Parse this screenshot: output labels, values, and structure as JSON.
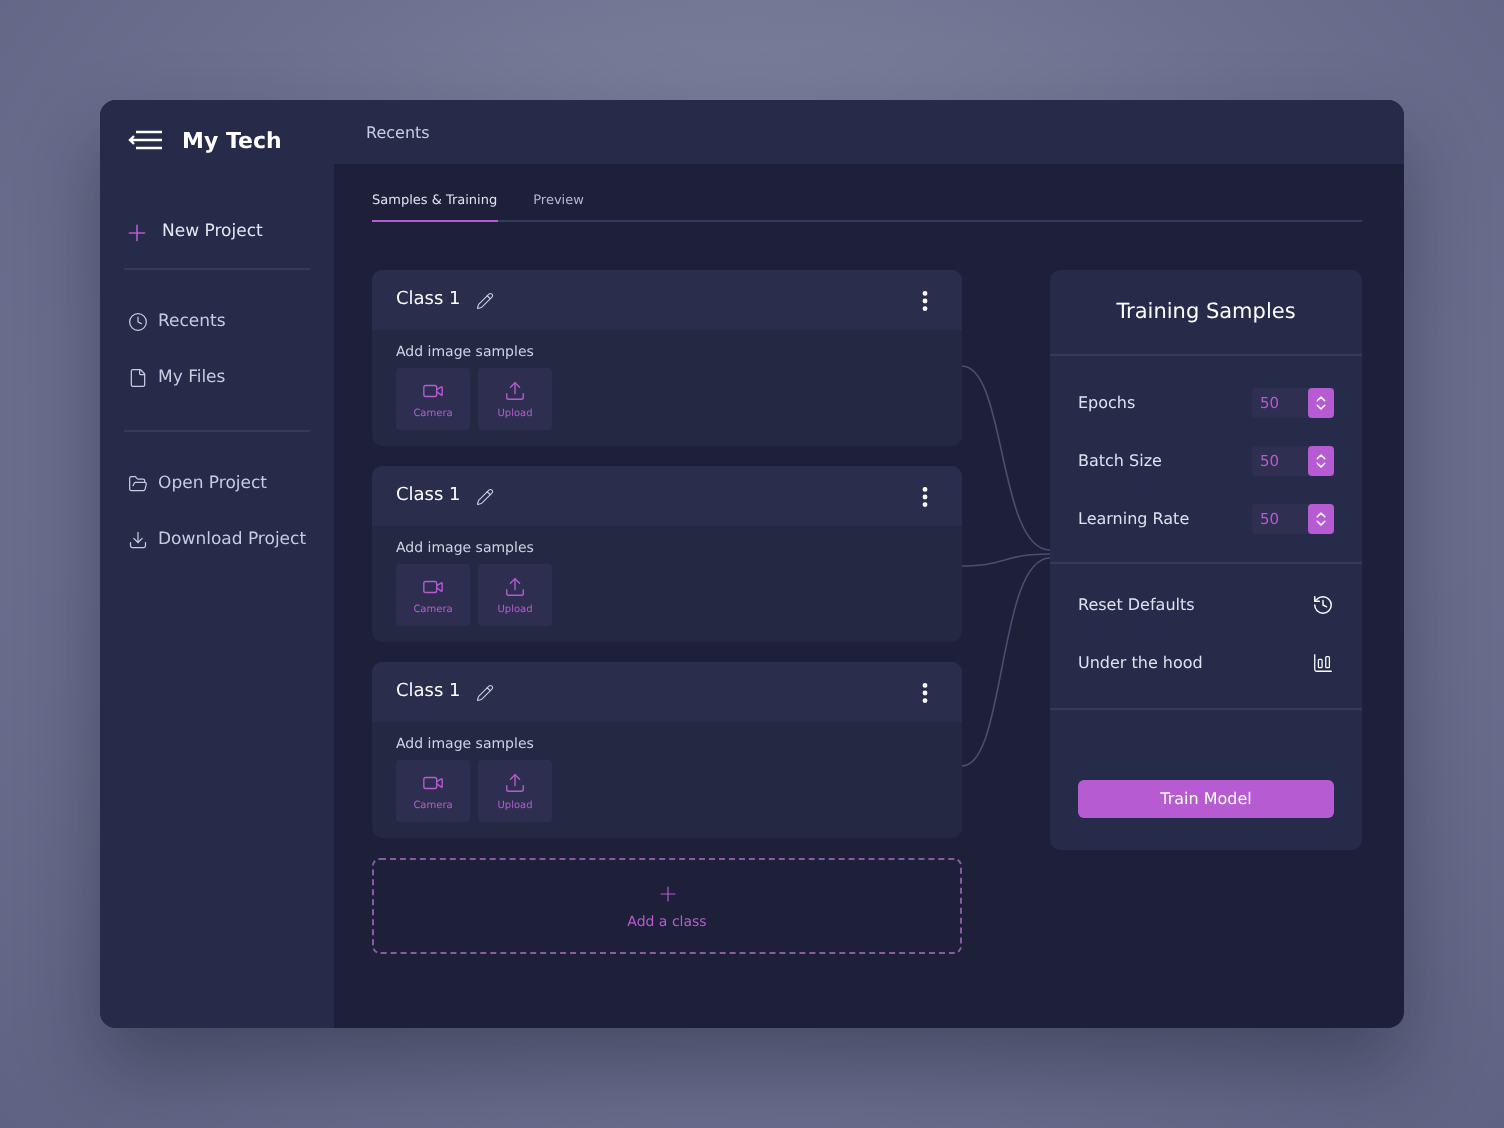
{
  "sidebar": {
    "title": "My Tech",
    "new_project": "New Project",
    "items": [
      {
        "label": "Recents",
        "kind": "clock"
      },
      {
        "label": "My Files",
        "kind": "file"
      }
    ],
    "actions": [
      {
        "label": "Open Project",
        "kind": "folder"
      },
      {
        "label": "Download Project",
        "kind": "download"
      }
    ]
  },
  "header": {
    "title": "Recents"
  },
  "tabs": [
    {
      "label": "Samples & Training",
      "selected": true
    },
    {
      "label": "Preview",
      "selected": false
    }
  ],
  "classes": [
    {
      "name": "Class 1",
      "prompt": "Add image samples",
      "buttons": [
        "Camera",
        "Upload"
      ]
    },
    {
      "name": "Class 1",
      "prompt": "Add image samples",
      "buttons": [
        "Camera",
        "Upload"
      ]
    },
    {
      "name": "Class 1",
      "prompt": "Add image samples",
      "buttons": [
        "Camera",
        "Upload"
      ]
    }
  ],
  "add_class": "Add a class",
  "training": {
    "title": "Training Samples",
    "params": [
      {
        "label": "Epochs",
        "value": "50"
      },
      {
        "label": "Batch Size",
        "value": "50"
      },
      {
        "label": "Learning Rate",
        "value": "50"
      }
    ],
    "links": [
      {
        "label": "Reset Defaults",
        "kind": "history"
      },
      {
        "label": "Under the hood",
        "kind": "chart"
      }
    ],
    "button": "Train Model"
  }
}
